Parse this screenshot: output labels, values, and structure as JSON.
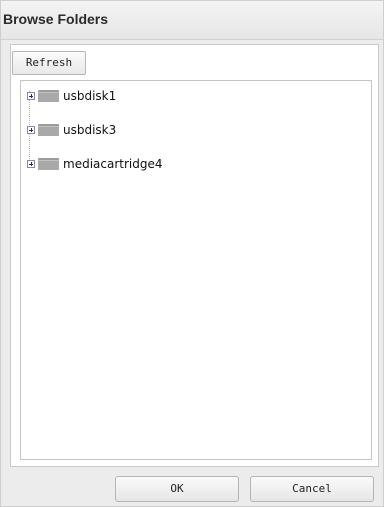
{
  "dialog": {
    "title": "Browse Folders"
  },
  "toolbar": {
    "refresh_label": "Refresh"
  },
  "tree": {
    "items": [
      {
        "label": "usbdisk1",
        "expanded": false,
        "icon": "folder-icon"
      },
      {
        "label": "usbdisk3",
        "expanded": false,
        "icon": "folder-icon"
      },
      {
        "label": "mediacartridge4",
        "expanded": false,
        "icon": "folder-icon"
      }
    ]
  },
  "footer": {
    "ok_label": "OK",
    "cancel_label": "Cancel"
  }
}
